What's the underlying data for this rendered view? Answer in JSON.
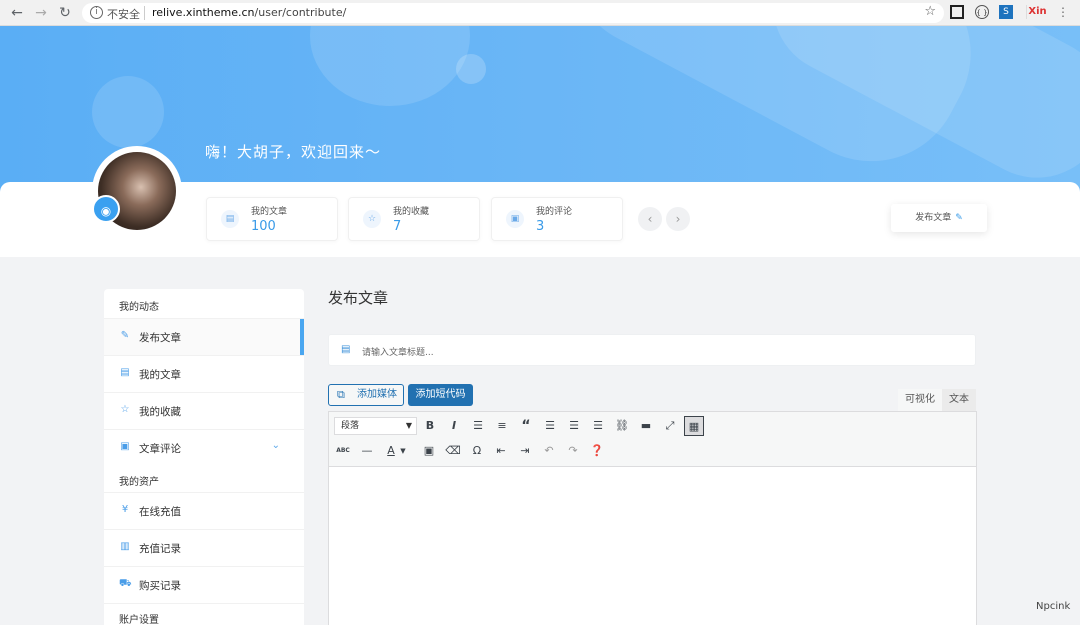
{
  "browser": {
    "security_label": "不安全",
    "url_host": "relive.xintheme.cn",
    "url_path": "/user/contribute/",
    "ext_label": "Xin"
  },
  "hero": {
    "greeting": "嗨！大胡子，欢迎回来～"
  },
  "stats": [
    {
      "label": "我的文章",
      "value": "100",
      "icon": "document-icon"
    },
    {
      "label": "我的收藏",
      "value": "7",
      "icon": "star-icon"
    },
    {
      "label": "我的评论",
      "value": "3",
      "icon": "comment-icon"
    }
  ],
  "publish_button": {
    "label": "发布文章"
  },
  "sidebar": {
    "section1": "我的动态",
    "items1": [
      {
        "label": "发布文章",
        "icon": "edit-icon",
        "active": true
      },
      {
        "label": "我的文章",
        "icon": "document-icon"
      },
      {
        "label": "我的收藏",
        "icon": "star-icon"
      },
      {
        "label": "文章评论",
        "icon": "comment-icon"
      }
    ],
    "section2": "我的资产",
    "items2": [
      {
        "label": "在线充值",
        "icon": "yen-icon"
      },
      {
        "label": "充值记录",
        "icon": "receipt-icon"
      },
      {
        "label": "购买记录",
        "icon": "cart-icon"
      }
    ],
    "section3": "账户设置"
  },
  "main": {
    "title": "发布文章",
    "title_placeholder": "请输入文章标题...",
    "add_media": "添加媒体",
    "add_shortcode": "添加短代码",
    "tab_visual": "可视化",
    "tab_text": "文本",
    "format_select": "段落"
  },
  "colors": {
    "accent": "#3a9be8",
    "wp_blue": "#2271b1",
    "hero_start": "#5aaef5",
    "hero_end": "#78bff8"
  },
  "watermark": "Npcink"
}
